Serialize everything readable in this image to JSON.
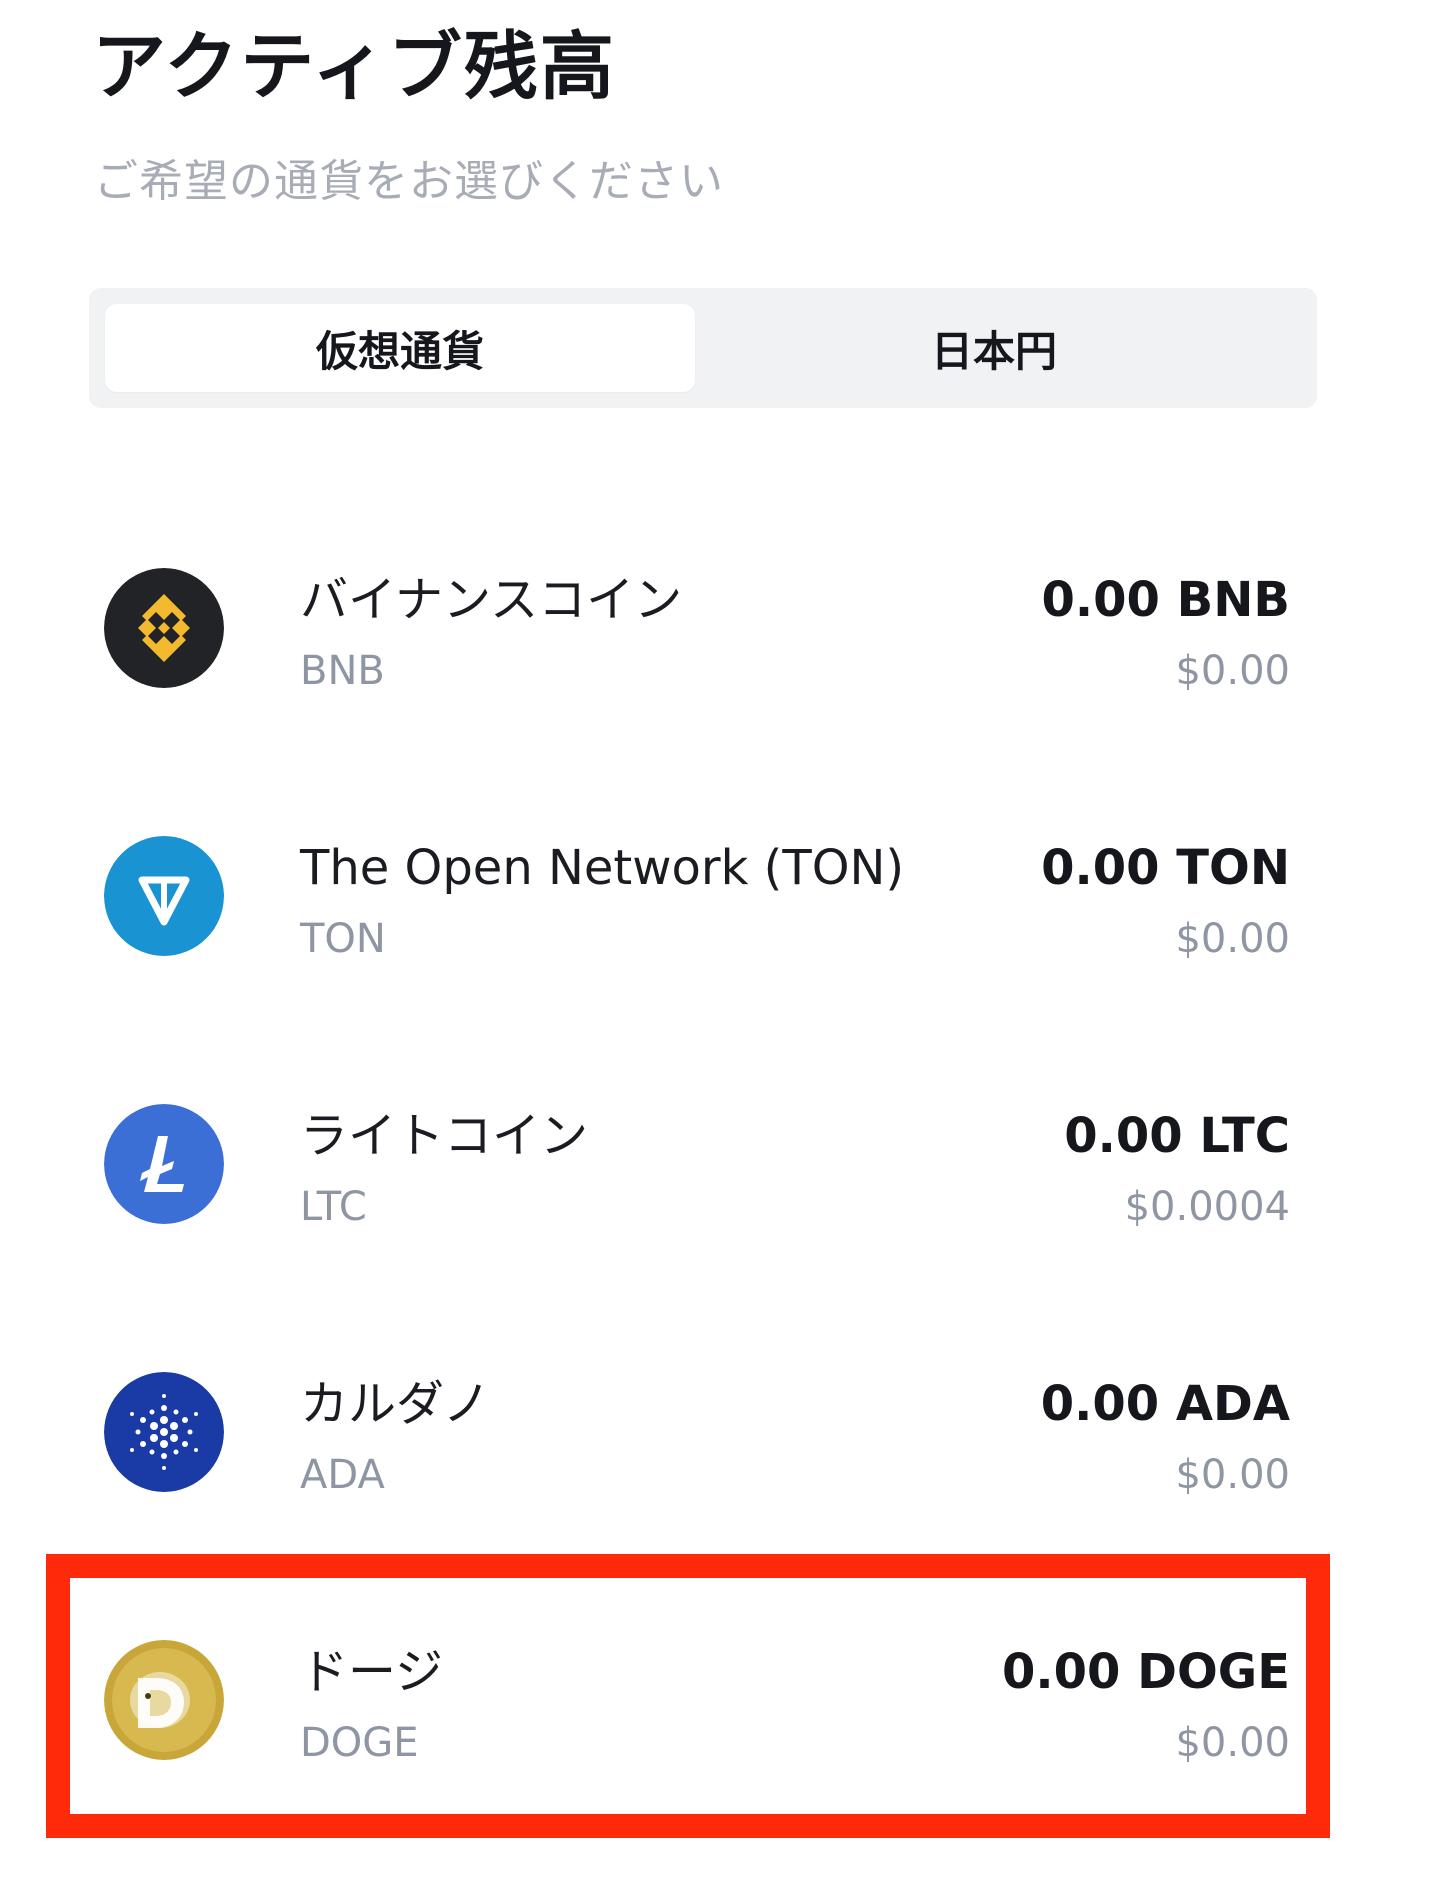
{
  "header": {
    "title": "アクティブ残高",
    "subtitle": "ご希望の通貨をお選びください"
  },
  "tabs": [
    {
      "label": "仮想通貨",
      "active": true
    },
    {
      "label": "日本円",
      "active": false
    }
  ],
  "assets": [
    {
      "name": "バイナンスコイン",
      "symbol": "BNB",
      "amount": "0.00 BNB",
      "fiat": "$0.00",
      "icon": "bnb-icon",
      "icon_color": "#222326",
      "accent_color": "#f3ba2f"
    },
    {
      "name": "The Open Network (TON)",
      "symbol": "TON",
      "amount": "0.00 TON",
      "fiat": "$0.00",
      "icon": "ton-icon",
      "icon_color": "#1993d1",
      "accent_color": "#ffffff"
    },
    {
      "name": "ライトコイン",
      "symbol": "LTC",
      "amount": "0.00 LTC",
      "fiat": "$0.0004",
      "icon": "litecoin-icon",
      "icon_color": "#3c6fd6",
      "accent_color": "#ffffff"
    },
    {
      "name": "カルダノ",
      "symbol": "ADA",
      "amount": "0.00 ADA",
      "fiat": "$0.00",
      "icon": "cardano-icon",
      "icon_color": "#1a3aa6",
      "accent_color": "#ffffff"
    },
    {
      "name": "ドージ",
      "symbol": "DOGE",
      "amount": "0.00 DOGE",
      "fiat": "$0.00",
      "icon": "dogecoin-icon",
      "icon_color": "#c9a63a",
      "accent_color": "#e8d9a0"
    }
  ],
  "highlight": {
    "target": "ドージ",
    "color": "#ff2a0a"
  }
}
